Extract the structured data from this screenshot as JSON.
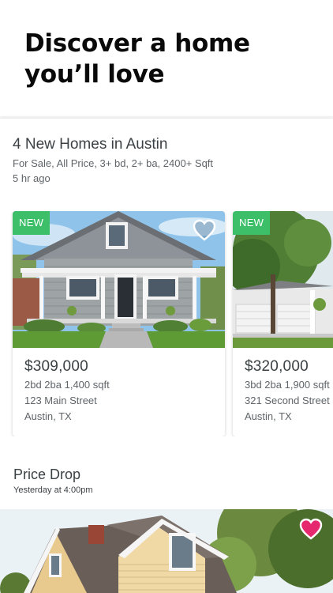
{
  "hero": {
    "headline": "Discover a home you’ll love"
  },
  "new_homes": {
    "title": "4 New Homes in Austin",
    "filters": "For Sale, All Price, 3+ bd, 2+ ba, 2400+ Sqft",
    "time": "5 hr ago",
    "listings": [
      {
        "badge": "NEW",
        "price": "$309,000",
        "specs": "2bd 2ba 1,400 sqft",
        "street": "123 Main Street",
        "city": "Austin, TX",
        "favorite_icon": "heart-outline-icon"
      },
      {
        "badge": "NEW",
        "price": "$320,000",
        "specs": "3bd 2ba 1,900 sqft",
        "street": "321 Second Street",
        "city": "Austin, TX"
      }
    ]
  },
  "price_drop": {
    "title": "Price Drop",
    "time": "Yesterday at 4:00pm",
    "favorite_icon": "heart-filled-icon"
  },
  "colors": {
    "badge": "#3dbf6a",
    "heart_outline": "#4a7ea8",
    "heart_filled": "#e6286e",
    "text": "#3b4144"
  }
}
